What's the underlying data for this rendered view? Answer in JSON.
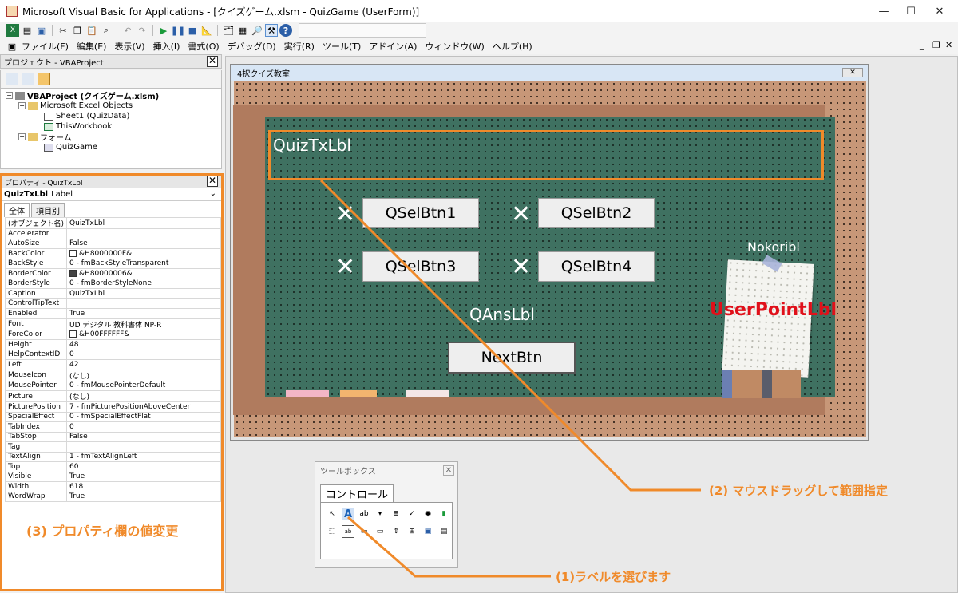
{
  "window": {
    "title": "Microsoft Visual Basic for Applications - [クイズゲーム.xlsm - QuizGame (UserForm)]",
    "minimize": "—",
    "maximize": "☐",
    "close": "✕"
  },
  "menu": {
    "items": [
      "ファイル(F)",
      "編集(E)",
      "表示(V)",
      "挿入(I)",
      "書式(O)",
      "デバッグ(D)",
      "実行(R)",
      "ツール(T)",
      "アドイン(A)",
      "ウィンドウ(W)",
      "ヘルプ(H)"
    ],
    "mdi_min": "_",
    "mdi_restore": "❐",
    "mdi_close": "✕"
  },
  "project": {
    "pane_title": "プロジェクト - VBAProject",
    "close": "✕",
    "tree": {
      "root": "VBAProject (クイズゲーム.xlsm)",
      "excel_objects": "Microsoft Excel Objects",
      "sheet1": "Sheet1 (QuizData)",
      "workbook": "ThisWorkbook",
      "forms": "フォーム",
      "form": "QuizGame"
    }
  },
  "properties": {
    "pane_title": "プロパティ - QuizTxLbl",
    "close": "✕",
    "object_name": "QuizTxLbl",
    "object_type": "Label",
    "tab_all": "全体",
    "tab_category": "項目別",
    "rows": [
      [
        "(オブジェクト名)",
        "QuizTxLbl"
      ],
      [
        "Accelerator",
        ""
      ],
      [
        "AutoSize",
        "False"
      ],
      [
        "BackColor",
        "&H8000000F&"
      ],
      [
        "BackStyle",
        "0 - fmBackStyleTransparent"
      ],
      [
        "BorderColor",
        "&H80000006&"
      ],
      [
        "BorderStyle",
        "0 - fmBorderStyleNone"
      ],
      [
        "Caption",
        "QuizTxLbl"
      ],
      [
        "ControlTipText",
        ""
      ],
      [
        "Enabled",
        "True"
      ],
      [
        "Font",
        "UD デジタル 教科書体 NP-R"
      ],
      [
        "ForeColor",
        "&H00FFFFFF&"
      ],
      [
        "Height",
        "48"
      ],
      [
        "HelpContextID",
        "0"
      ],
      [
        "Left",
        "42"
      ],
      [
        "MouseIcon",
        "(なし)"
      ],
      [
        "MousePointer",
        "0 - fmMousePointerDefault"
      ],
      [
        "Picture",
        "(なし)"
      ],
      [
        "PicturePosition",
        "7 - fmPicturePositionAboveCenter"
      ],
      [
        "SpecialEffect",
        "0 - fmSpecialEffectFlat"
      ],
      [
        "TabIndex",
        "0"
      ],
      [
        "TabStop",
        "False"
      ],
      [
        "Tag",
        ""
      ],
      [
        "TextAlign",
        "1 - fmTextAlignLeft"
      ],
      [
        "Top",
        "60"
      ],
      [
        "Visible",
        "True"
      ],
      [
        "Width",
        "618"
      ],
      [
        "WordWrap",
        "True"
      ]
    ],
    "swatches": {
      "BackColor": "#ffffff",
      "BorderColor": "#444444",
      "ForeColor": "#ffffff"
    }
  },
  "userform": {
    "caption": "4択クイズ教室",
    "close": "✕",
    "quiz_label": "QuizTxLbl",
    "buttons": [
      "QSelBtn1",
      "QSelBtn2",
      "QSelBtn3",
      "QSelBtn4"
    ],
    "x_mark": "✕",
    "answer_label": "QAnsLbl",
    "next_button": "NextBtn",
    "nokori_label": "Nokoribl",
    "point_label": "UserPointLbl"
  },
  "toolbox": {
    "title": "ツールボックス",
    "close": "✕",
    "tab": "コントロール",
    "label_tool": "A"
  },
  "annotations": {
    "step1": "(1)ラベルを選びます",
    "step2": "(2) マウスドラッグして範囲指定",
    "step3": "(3) プロパティ欄の値変更"
  },
  "colors": {
    "accent_orange": "#f08a2a",
    "board_green": "#3f7161",
    "point_red": "#e0101a"
  }
}
